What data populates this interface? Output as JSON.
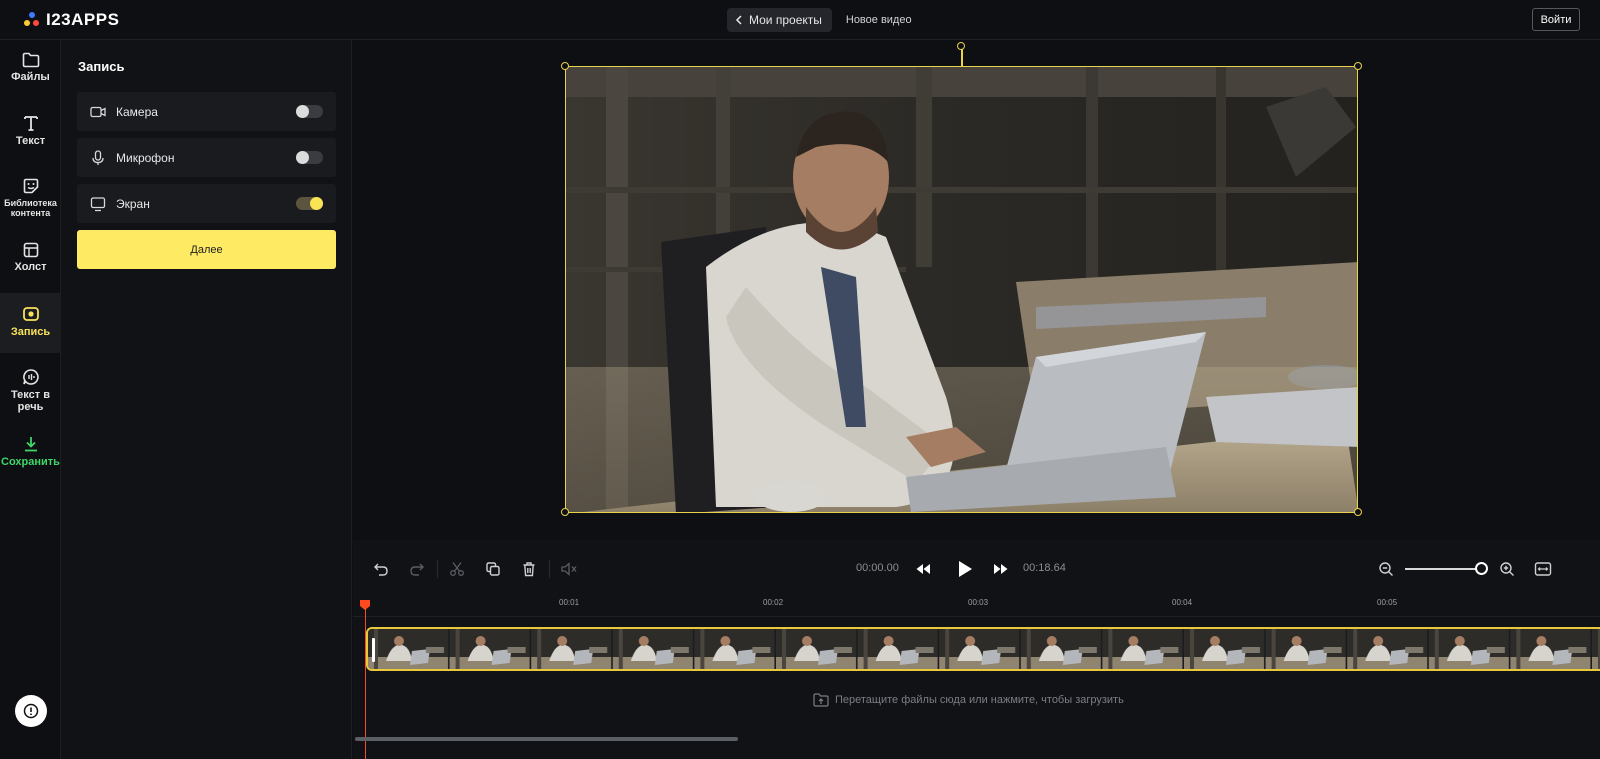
{
  "header": {
    "logo_text": "I23APPS",
    "back_label": "Мои проекты",
    "project_name": "Новое видео",
    "login_label": "Войти"
  },
  "rail": {
    "files": "Файлы",
    "text": "Текст",
    "library": "Библиотека контента",
    "canvas": "Холст",
    "record": "Запись",
    "tts": "Текст в речь",
    "save": "Сохранить"
  },
  "panel": {
    "title": "Запись",
    "options": [
      {
        "label": "Камера",
        "enabled": false
      },
      {
        "label": "Микрофон",
        "enabled": false
      },
      {
        "label": "Экран",
        "enabled": true
      }
    ],
    "next_label": "Далее"
  },
  "player": {
    "current_time": "00:00.00",
    "total_time": "00:18.64"
  },
  "timeline": {
    "ticks": [
      "00:01",
      "00:02",
      "00:03",
      "00:04",
      "00:05"
    ],
    "drop_hint": "Перетащите файлы сюда или нажмите, чтобы загрузить"
  },
  "colors": {
    "accent": "#ffea63",
    "selection": "#e9d34c",
    "playhead": "#ff4a1f",
    "save": "#3fd66a"
  }
}
